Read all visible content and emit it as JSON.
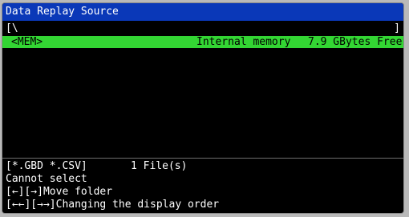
{
  "window": {
    "title": "Data Replay Source"
  },
  "path": {
    "left": "[\\",
    "right": "]"
  },
  "files": [
    {
      "name": "<MEM>",
      "description": "Internal memory",
      "size": "7.9 GBytes Free"
    }
  ],
  "status": {
    "filter": "[*.GBD *.CSV]",
    "file_count": "1 File(s)"
  },
  "messages": {
    "line1": "Cannot select",
    "line2": "[←][→]Move folder",
    "line3": "[←←][→→]Changing the display order"
  },
  "colors": {
    "title_bar": "#0a38b8",
    "selection": "#33d633",
    "background": "#000000",
    "text": "#ffffff"
  }
}
